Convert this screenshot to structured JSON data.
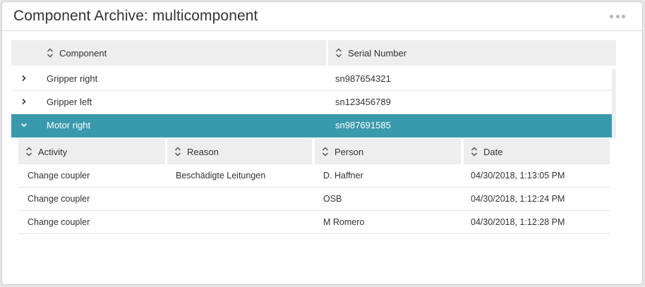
{
  "header": {
    "title": "Component Archive: multicomponent",
    "menu_icon": "more-horizontal-icon"
  },
  "outer_table": {
    "columns": [
      "Component",
      "Serial Number"
    ],
    "rows": [
      {
        "component": "Gripper right",
        "serial": "sn987654321",
        "expanded": false
      },
      {
        "component": "Gripper left",
        "serial": "sn123456789",
        "expanded": false
      },
      {
        "component": "Motor right",
        "serial": "sn987691585",
        "expanded": true
      }
    ]
  },
  "detail_table": {
    "columns": [
      "Activity",
      "Reason",
      "Person",
      "Date"
    ],
    "rows": [
      {
        "activity": "Change coupler",
        "reason": "Beschädigte Leitungen",
        "person": "D. Haffner",
        "date": "04/30/2018, 1:13:05 PM"
      },
      {
        "activity": "Change coupler",
        "reason": "",
        "person": "OSB",
        "date": "04/30/2018, 1:12:24 PM"
      },
      {
        "activity": "Change coupler",
        "reason": "",
        "person": "M Romero",
        "date": "04/30/2018, 1:12:28 PM"
      }
    ]
  },
  "colors": {
    "selected_row": "#3a9aad",
    "header_bg": "#eeeeee"
  }
}
